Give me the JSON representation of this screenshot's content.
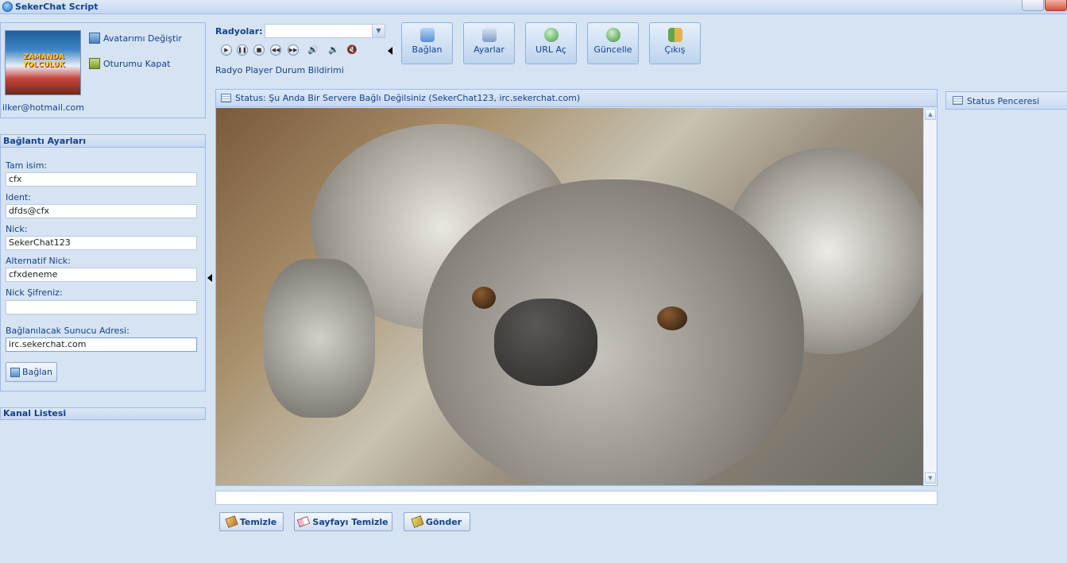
{
  "window": {
    "title": "SekerChat Script"
  },
  "profile": {
    "avatar_change": "Avatarımı Değiştir",
    "logout": "Oturumu Kapat",
    "email": "ilker@hotmail.com",
    "avatar_caption": "ZAMANDA YOLCULUK"
  },
  "connection": {
    "title": "Bağlantı Ayarları",
    "fields": [
      {
        "label": "Tam isim:",
        "value": "cfx"
      },
      {
        "label": "Ident:",
        "value": "dfds@cfx"
      },
      {
        "label": "Nick:",
        "value": "SekerChat123"
      },
      {
        "label": "Alternatif Nick:",
        "value": "cfxdeneme"
      },
      {
        "label": "Nick Şifreniz:",
        "value": ""
      },
      {
        "label": "Bağlanılacak Sunucu Adresi:",
        "value": "irc.sekerchat.com"
      }
    ],
    "connect_button": "Bağlan"
  },
  "channels": {
    "title": "Kanal Listesi"
  },
  "radio": {
    "label": "Radyolar:",
    "selected": "",
    "status": "Radyo Player Durum Bildirimi"
  },
  "toolbar": {
    "buttons": [
      {
        "label": "Bağlan",
        "icon": "plug-icon",
        "color": "#5a8fd6"
      },
      {
        "label": "Ayarlar",
        "icon": "wrench-icon",
        "color": "#7d9cc4"
      },
      {
        "label": "URL Aç",
        "icon": "globe-link-icon",
        "color": "#4caf50"
      },
      {
        "label": "Güncelle",
        "icon": "update-globe-icon",
        "color": "#43a047"
      },
      {
        "label": "Çıkış",
        "icon": "exit-door-icon",
        "color": "#c0892a"
      }
    ]
  },
  "status": {
    "header": "Status: Şu Anda Bir Servere Bağlı Değilsiniz (SekerChat123, irc.sekerchat.com)",
    "side_tab": "Status Penceresi"
  },
  "message": {
    "value": ""
  },
  "actions": {
    "clear": "Temizle",
    "clear_page": "Sayfayı Temizle",
    "send": "Gönder"
  }
}
